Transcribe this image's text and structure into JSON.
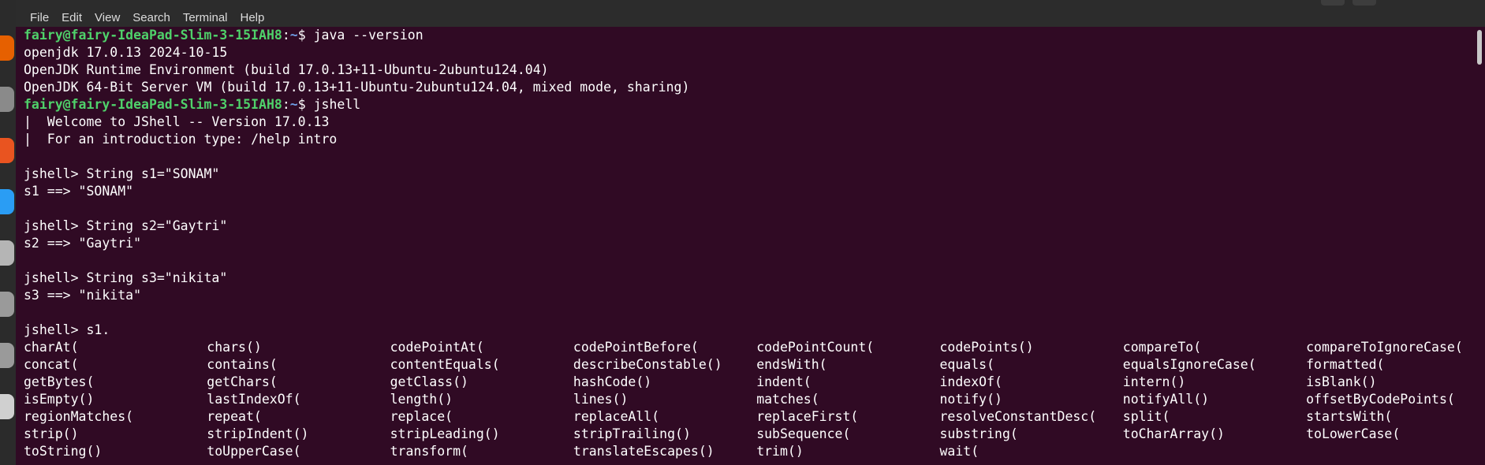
{
  "menu": [
    "File",
    "Edit",
    "View",
    "Search",
    "Terminal",
    "Help"
  ],
  "prompt": {
    "user_host": "fairy@fairy-IdeaPad-Slim-3-15IAH8",
    "separator": ":",
    "path": "~",
    "symbol": "$ "
  },
  "lines": [
    {
      "type": "prompt",
      "command": "java --version"
    },
    {
      "type": "text",
      "text": "openjdk 17.0.13 2024-10-15"
    },
    {
      "type": "text",
      "text": "OpenJDK Runtime Environment (build 17.0.13+11-Ubuntu-2ubuntu124.04)"
    },
    {
      "type": "text",
      "text": "OpenJDK 64-Bit Server VM (build 17.0.13+11-Ubuntu-2ubuntu124.04, mixed mode, sharing)"
    },
    {
      "type": "prompt",
      "command": "jshell"
    },
    {
      "type": "text",
      "text": "|  Welcome to JShell -- Version 17.0.13"
    },
    {
      "type": "text",
      "text": "|  For an introduction type: /help intro"
    },
    {
      "type": "text",
      "text": ""
    },
    {
      "type": "text",
      "text": "jshell> String s1=\"SONAM\""
    },
    {
      "type": "text",
      "text": "s1 ==> \"SONAM\""
    },
    {
      "type": "text",
      "text": ""
    },
    {
      "type": "text",
      "text": "jshell> String s2=\"Gaytri\""
    },
    {
      "type": "text",
      "text": "s2 ==> \"Gaytri\""
    },
    {
      "type": "text",
      "text": ""
    },
    {
      "type": "text",
      "text": "jshell> String s3=\"nikita\""
    },
    {
      "type": "text",
      "text": "s3 ==> \"nikita\""
    },
    {
      "type": "text",
      "text": ""
    },
    {
      "type": "text",
      "text": "jshell> s1."
    }
  ],
  "completions": [
    [
      "charAt(",
      "chars()",
      "codePointAt(",
      "codePointBefore(",
      "codePointCount(",
      "codePoints()",
      "compareTo(",
      "compareToIgnoreCase("
    ],
    [
      "concat(",
      "contains(",
      "contentEquals(",
      "describeConstable()",
      "endsWith(",
      "equals(",
      "equalsIgnoreCase(",
      "formatted("
    ],
    [
      "getBytes(",
      "getChars(",
      "getClass()",
      "hashCode()",
      "indent(",
      "indexOf(",
      "intern()",
      "isBlank()"
    ],
    [
      "isEmpty()",
      "lastIndexOf(",
      "length()",
      "lines()",
      "matches(",
      "notify()",
      "notifyAll()",
      "offsetByCodePoints("
    ],
    [
      "regionMatches(",
      "repeat(",
      "replace(",
      "replaceAll(",
      "replaceFirst(",
      "resolveConstantDesc(",
      "split(",
      "startsWith("
    ],
    [
      "strip()",
      "stripIndent()",
      "stripLeading()",
      "stripTrailing()",
      "subSequence(",
      "substring(",
      "toCharArray()",
      "toLowerCase("
    ],
    [
      "toString()",
      "toUpperCase(",
      "transform(",
      "translateEscapes()",
      "trim()",
      "wait(",
      "",
      ""
    ]
  ],
  "dock_icons": [
    {
      "name": "firefox-icon",
      "color": "#e66000"
    },
    {
      "name": "files-icon",
      "color": "#8a8a8a"
    },
    {
      "name": "app-center-icon",
      "color": "#e95420"
    },
    {
      "name": "help-icon",
      "color": "#2a9df4"
    },
    {
      "name": "search-tool-icon",
      "color": "#b5b5b5"
    },
    {
      "name": "drive-icon",
      "color": "#9a9a9a"
    },
    {
      "name": "drive-icon-2",
      "color": "#9a9a9a"
    },
    {
      "name": "document-icon",
      "color": "#d0d0d0"
    }
  ]
}
